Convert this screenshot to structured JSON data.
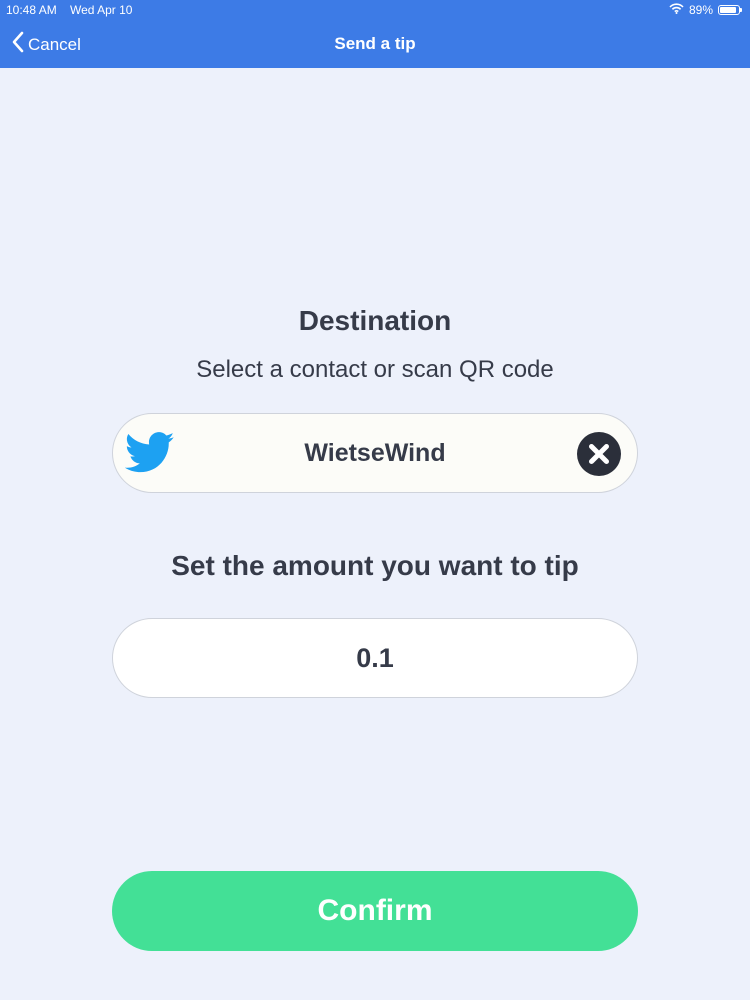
{
  "status_bar": {
    "time": "10:48 AM",
    "date": "Wed Apr 10",
    "battery": "89%",
    "battery_level": 0.89,
    "icons": [
      "wifi-icon",
      "battery-icon"
    ]
  },
  "nav": {
    "back_label": "Cancel",
    "title": "Send a tip"
  },
  "destination": {
    "heading": "Destination",
    "subheading": "Select a contact or scan QR code",
    "contact_name": "WietseWind",
    "service_icon": "twitter-bird-icon",
    "clear_icon": "close-circle-icon"
  },
  "amount": {
    "label": "Set the amount you want to tip",
    "value": "0.1"
  },
  "confirm_label": "Confirm",
  "colors": {
    "header": "#3d7be6",
    "background": "#edf1fb",
    "confirm": "#43e096",
    "twitter": "#1da1f2",
    "text": "#363b49"
  }
}
